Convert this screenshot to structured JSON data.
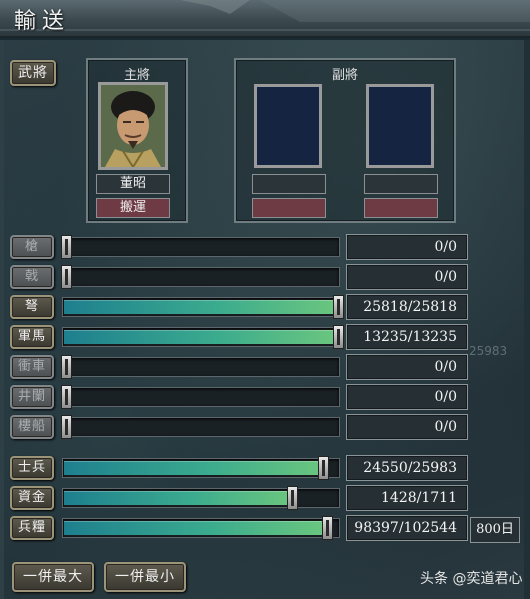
{
  "window": {
    "title": "輸送"
  },
  "general_button": "武將",
  "main_general": {
    "header": "主將",
    "name": "董昭",
    "role": "搬運"
  },
  "vice_general": {
    "header": "副將",
    "slots": [
      {
        "name": "",
        "role": ""
      },
      {
        "name": "",
        "role": ""
      }
    ]
  },
  "resources": [
    {
      "label": "槍",
      "value": "0/0",
      "fraction": 0,
      "enabled": false
    },
    {
      "label": "戟",
      "value": "0/0",
      "fraction": 0,
      "enabled": false
    },
    {
      "label": "弩",
      "value": "25818/25818",
      "fraction": 1.0,
      "enabled": true
    },
    {
      "label": "軍馬",
      "value": "13235/13235",
      "fraction": 1.0,
      "enabled": true
    },
    {
      "label": "衝車",
      "value": "0/0",
      "fraction": 0,
      "enabled": false
    },
    {
      "label": "井闌",
      "value": "0/0",
      "fraction": 0,
      "enabled": false
    },
    {
      "label": "樓船",
      "value": "0/0",
      "fraction": 0,
      "enabled": false
    },
    {
      "label": "士兵",
      "value": "24550/25983",
      "fraction": 0.9448,
      "enabled": true
    },
    {
      "label": "資金",
      "value": "1428/1711",
      "fraction": 0.8346,
      "enabled": true
    },
    {
      "label": "兵糧",
      "value": "98397/102544",
      "fraction": 0.9596,
      "enabled": true
    }
  ],
  "food_days": "800日",
  "background_ghost_number": "25983",
  "buttons": {
    "max_all": "一併最大",
    "min_all": "一併最小"
  },
  "watermark": "头条 @奕道君心",
  "colors": {
    "fill_start": "#1e7f8e",
    "fill_end": "#6cc77e",
    "role_bg": "#6e3a44",
    "slot_bg": "#142441"
  }
}
